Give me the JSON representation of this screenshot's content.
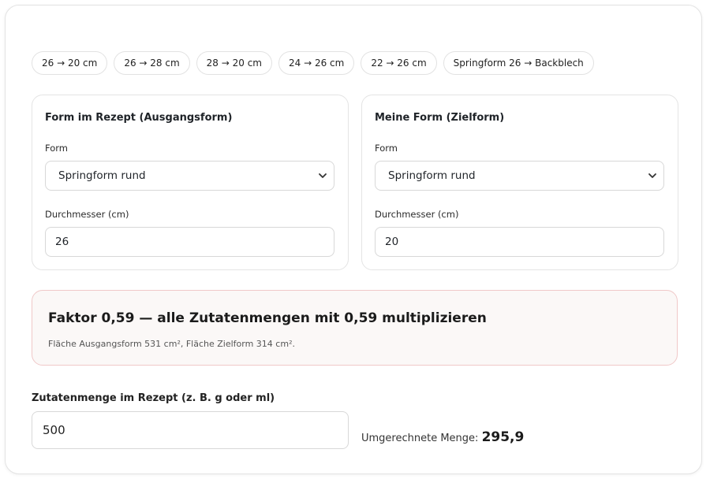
{
  "presets": [
    "26 → 20 cm",
    "26 → 28 cm",
    "28 → 20 cm",
    "24 → 26 cm",
    "22 → 26 cm",
    "Springform 26 → Backblech"
  ],
  "source_form": {
    "title": "Form im Rezept (Ausgangsform)",
    "form_label": "Form",
    "form_value": "Springform rund",
    "diameter_label": "Durchmesser (cm)",
    "diameter_value": "26"
  },
  "target_form": {
    "title": "Meine Form (Zielform)",
    "form_label": "Form",
    "form_value": "Springform rund",
    "diameter_label": "Durchmesser (cm)",
    "diameter_value": "20"
  },
  "result": {
    "headline": "Faktor 0,59 — alle Zutatenmengen mit 0,59 multiplizieren",
    "detail": "Fläche Ausgangsform 531 cm², Fläche Zielform 314 cm²."
  },
  "amount": {
    "label": "Zutatenmenge im Rezept (z. B. g oder ml)",
    "value": "500",
    "converted_label": "Umgerechnete Menge: ",
    "converted_value": "295,9"
  },
  "icons": {
    "select_chevron": "chevron-down-icon"
  },
  "colors": {
    "result_border": "#f0c8c8",
    "result_background": "#fbf8f7"
  }
}
